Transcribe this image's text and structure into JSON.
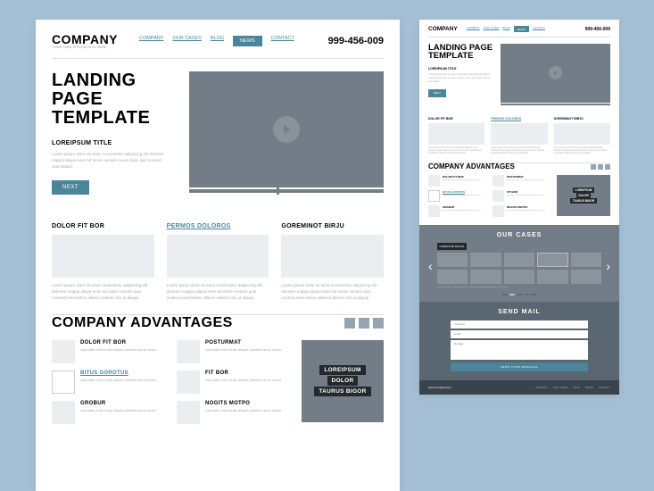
{
  "brand": "COMPANY",
  "tagline": "YOUR OWN SPECIALISTS HERE",
  "phone": "999-456-009",
  "nav": [
    "COMPANY",
    "OUR CASES",
    "BLOG",
    "NEWS",
    "CONTACT"
  ],
  "nav_active": 3,
  "hero": {
    "title": "LANDING PAGE TEMPLATE",
    "subtitle": "LOREIPSUM TITLE",
    "lorem": "Lorem ipsum dolor sit amet, consectetur adipiscing elit dolorem magna aliqua enim ad minim veniam lorem dolor quis nostrud exercitation",
    "button": "NEXT"
  },
  "cols": [
    {
      "title": "DOLOR FIT BOR",
      "link": false,
      "text": "Lorem ipsum dolor sit amet consectetur adipiscing elit dolorem magna aliqua enim ad minim veniam quis nostrud exercitation ullamco laboris nisi ut aliquip"
    },
    {
      "title": "PERMOS DOLOROS",
      "link": true,
      "text": "Lorem ipsum dolor sit amet consectetur adipiscing elit dolorem magna aliqua enim ad minim veniam quis nostrud exercitation ullamco laboris nisi ut aliquip"
    },
    {
      "title": "GOREMINOT BIRJU",
      "link": false,
      "text": "Lorem ipsum dolor sit amet consectetur adipiscing elit dolorem magna aliqua enim ad minim veniam quis nostrud exercitation ullamco laboris nisi ut aliquip"
    }
  ],
  "advantages": {
    "title": "COMPANY ADVANTAGES",
    "col1": [
      {
        "title": "DOLOR FIT BOR",
        "link": false,
        "text": "vulputate enim nulla aliquet porttitor lacus luctus"
      },
      {
        "title": "BITUS GOROTUS",
        "link": true,
        "text": "vulputate enim nulla aliquet porttitor lacus luctus"
      },
      {
        "title": "GROBUR",
        "link": false,
        "text": "vulputate enim nulla aliquet porttitor lacus luctus"
      }
    ],
    "col2": [
      {
        "title": "POSTURMAT",
        "link": false,
        "text": "vulputate enim nulla aliquet porttitor lacus luctus"
      },
      {
        "title": "FIT BOR",
        "link": false,
        "text": "vulputate enim nulla aliquet porttitor lacus luctus"
      },
      {
        "title": "NOGITS MOTPO",
        "link": false,
        "text": "vulputate enim nulla aliquet porttitor lacus luctus"
      }
    ],
    "feature": [
      "LOREIPSUM",
      "DOLOR",
      "TAURUS BIGOR"
    ]
  },
  "cases": {
    "title": "OUR CASES",
    "label": "LOREIPSUM DOLOR",
    "text": "Lorem ipsum dolor sit amet consectetur adipiscing elit dolorem magna aliqua enim veniam"
  },
  "mail": {
    "title": "SEND MAIL",
    "name_ph": "Your name",
    "email_ph": "E-mail",
    "msg_ph": "Message",
    "button": "SEND YOUR MESSAGE"
  },
  "footer": {
    "site": "www.company.com"
  }
}
